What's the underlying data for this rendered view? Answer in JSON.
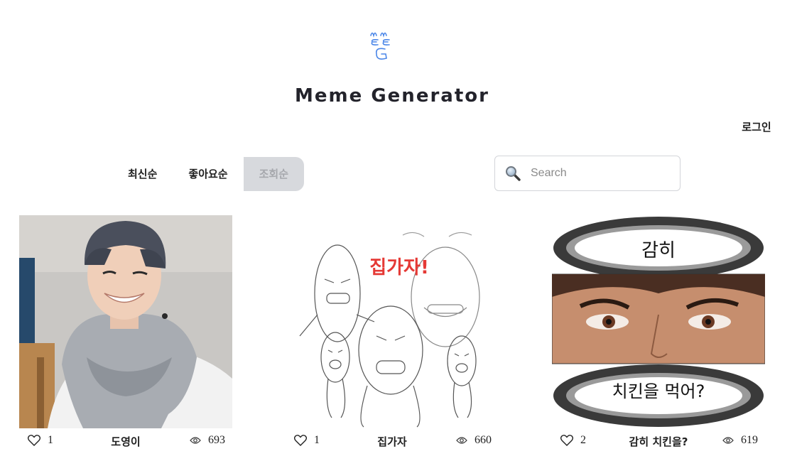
{
  "header": {
    "logo_icon": "meme-doodle-logo",
    "title": "Meme Generator",
    "login_label": "로그인"
  },
  "sort": {
    "tabs": [
      {
        "label": "최신순",
        "active": false
      },
      {
        "label": "좋아요순",
        "active": false
      },
      {
        "label": "조회순",
        "active": true
      }
    ]
  },
  "search": {
    "icon": "magnifier-icon",
    "placeholder": "Search",
    "value": ""
  },
  "cards": [
    {
      "caption": "도영이",
      "likes": "1",
      "views": "693"
    },
    {
      "caption": "집가자",
      "likes": "1",
      "views": "660"
    },
    {
      "caption": "감히 치킨을?",
      "likes": "2",
      "views": "619"
    }
  ],
  "meme_texts": {
    "card2_overlay": "집가자!",
    "card3_top": "감히",
    "card3_bottom": "치킨을 먹어?"
  },
  "colors": {
    "logo_blue": "#4a86e8",
    "active_tab_bg": "#d7d9dd",
    "meme_red": "#e53935"
  }
}
